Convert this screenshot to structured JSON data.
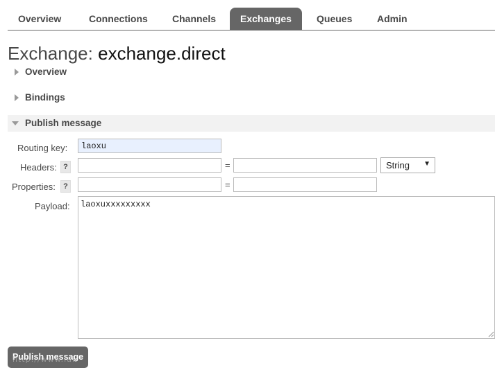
{
  "nav": {
    "tabs": [
      {
        "label": "Overview",
        "active": false
      },
      {
        "label": "Connections",
        "active": false
      },
      {
        "label": "Channels",
        "active": false
      },
      {
        "label": "Exchanges",
        "active": true
      },
      {
        "label": "Queues",
        "active": false
      },
      {
        "label": "Admin",
        "active": false
      }
    ]
  },
  "page": {
    "title_prefix": "Exchange:",
    "title_name": "exchange.direct"
  },
  "sections": {
    "overview": {
      "label": "Overview",
      "expanded": false
    },
    "bindings": {
      "label": "Bindings",
      "expanded": false
    },
    "publish": {
      "label": "Publish message",
      "expanded": true
    }
  },
  "publish_form": {
    "routing_key_label": "Routing key:",
    "routing_key_value": "laoxu",
    "headers_label": "Headers:",
    "headers_help": "?",
    "headers_key": "",
    "headers_value": "",
    "headers_type": "String",
    "properties_label": "Properties:",
    "properties_help": "?",
    "properties_key": "",
    "properties_value": "",
    "equals_sign": "=",
    "payload_label": "Payload:",
    "payload_value": "laoxuxxxxxxxxx",
    "submit_label": "Publish message"
  },
  "watermark": "http://www.lai",
  "colors": {
    "nav_active_bg": "#666666",
    "button_bg": "#666666",
    "text": "#484848",
    "autofill_bg": "#e8f0fe"
  }
}
